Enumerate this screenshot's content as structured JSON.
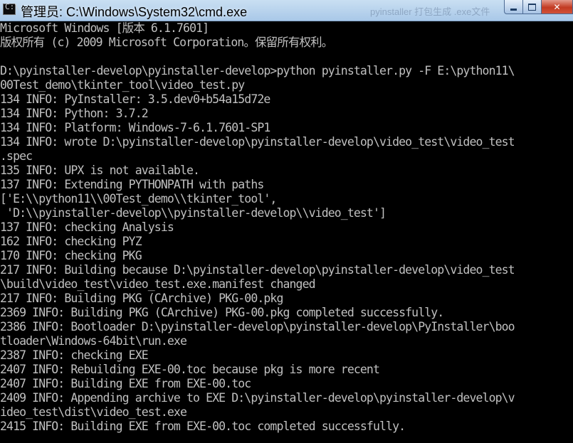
{
  "window": {
    "title": "管理员: C:\\Windows\\System32\\cmd.exe",
    "background_tab_text": "pyinstaller 打包生成 .exe文件"
  },
  "colors": {
    "console_background": "#000000",
    "console_text": "#c0c0c0",
    "titlebar": "#b9d3ee",
    "close_button": "#c7432b"
  },
  "console": {
    "lines": [
      "Microsoft Windows [版本 6.1.7601]",
      "版权所有 (c) 2009 Microsoft Corporation。保留所有权利。",
      "",
      "D:\\pyinstaller-develop\\pyinstaller-develop>python pyinstaller.py -F E:\\python11\\",
      "00Test_demo\\tkinter_tool\\video_test.py",
      "134 INFO: PyInstaller: 3.5.dev0+b54a15d72e",
      "134 INFO: Python: 3.7.2",
      "134 INFO: Platform: Windows-7-6.1.7601-SP1",
      "134 INFO: wrote D:\\pyinstaller-develop\\pyinstaller-develop\\video_test\\video_test",
      ".spec",
      "135 INFO: UPX is not available.",
      "137 INFO: Extending PYTHONPATH with paths",
      "['E:\\\\python11\\\\00Test_demo\\\\tkinter_tool',",
      " 'D:\\\\pyinstaller-develop\\\\pyinstaller-develop\\\\video_test']",
      "137 INFO: checking Analysis",
      "162 INFO: checking PYZ",
      "170 INFO: checking PKG",
      "217 INFO: Building because D:\\pyinstaller-develop\\pyinstaller-develop\\video_test",
      "\\build\\video_test\\video_test.exe.manifest changed",
      "217 INFO: Building PKG (CArchive) PKG-00.pkg",
      "2369 INFO: Building PKG (CArchive) PKG-00.pkg completed successfully.",
      "2386 INFO: Bootloader D:\\pyinstaller-develop\\pyinstaller-develop\\PyInstaller\\boo",
      "tloader\\Windows-64bit\\run.exe",
      "2387 INFO: checking EXE",
      "2407 INFO: Rebuilding EXE-00.toc because pkg is more recent",
      "2407 INFO: Building EXE from EXE-00.toc",
      "2409 INFO: Appending archive to EXE D:\\pyinstaller-develop\\pyinstaller-develop\\v",
      "ideo_test\\dist\\video_test.exe",
      "2415 INFO: Building EXE from EXE-00.toc completed successfully."
    ]
  }
}
